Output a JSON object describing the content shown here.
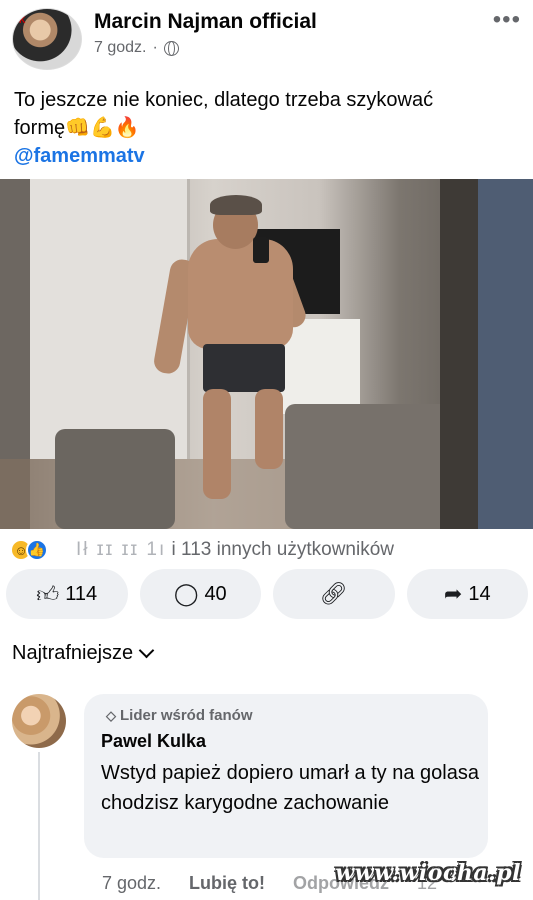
{
  "post": {
    "author": "Marcin Najman official",
    "time": "7 godz.",
    "dot": "·",
    "more": "•••",
    "avatar_brand": "K",
    "text_line1": "To jeszcze nie koniec, dlatego trzeba szykować",
    "text_line2": "formę",
    "emojis": "👊💪🔥",
    "mention": "@famemmatv"
  },
  "reactions": {
    "icons": [
      "haha-icon",
      "like-icon"
    ],
    "blurred_names": "Ił  ɪɪ ɪɪ 1ı",
    "summary": "i 113 innych użytkowników"
  },
  "actions": {
    "like_count": "114",
    "comment_count": "40",
    "share_count": "14"
  },
  "comments": {
    "sort_label": "Najtrafniejsze",
    "items": [
      {
        "badge": "Lider wśród fanów",
        "author": "Pawel Kulka",
        "text": "Wstyd papież dopiero umarł a ty na golasa chodzisz karygodne zachowanie",
        "time": "7 godz.",
        "like_label": "Lubię to!",
        "reply_label": "Odpowiedz",
        "reaction_count": "12"
      }
    ]
  },
  "watermark": "www.wiocha.pl",
  "colors": {
    "link_blue": "#1b74e4",
    "secondary_text": "#65676b",
    "bubble_bg": "#f0f2f5",
    "button_bg": "#eef0f3"
  }
}
